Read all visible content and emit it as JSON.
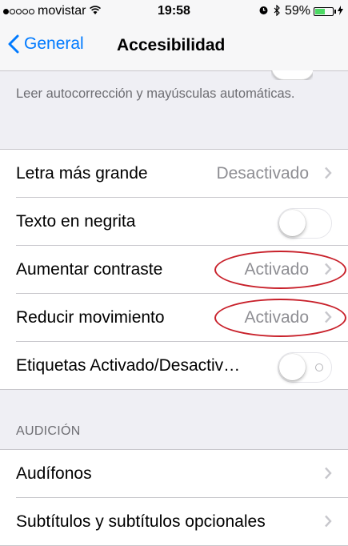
{
  "status_bar": {
    "carrier": "movistar",
    "signal_bars_filled": 1,
    "signal_bars_total": 5,
    "time": "19:58",
    "battery_percent": "59%",
    "battery_level": 0.59
  },
  "nav": {
    "back_label": "General",
    "title": "Accesibilidad"
  },
  "footer_note": "Leer autocorrección y mayúsculas automáticas.",
  "group1": [
    {
      "label": "Letra más grande",
      "value": "Desactivado",
      "type": "disclosure"
    },
    {
      "label": "Texto en negrita",
      "type": "switch",
      "on": false
    },
    {
      "label": "Aumentar contraste",
      "value": "Activado",
      "type": "disclosure",
      "circled": true
    },
    {
      "label": "Reducir movimiento",
      "value": "Activado",
      "type": "disclosure",
      "circled": true
    },
    {
      "label": "Etiquetas Activado/Desactiv…",
      "type": "switch",
      "on": false,
      "labels": true
    }
  ],
  "section_audicion": "AUDICIÓN",
  "group2": [
    {
      "label": "Audífonos",
      "type": "disclosure"
    },
    {
      "label": "Subtítulos y subtítulos opcionales",
      "type": "disclosure"
    }
  ],
  "colors": {
    "accent": "#007aff",
    "annotation": "#c8202a",
    "battery": "#4cd964"
  },
  "icons": {
    "wifi": "wifi-icon",
    "alarm": "alarm-icon",
    "bluetooth": "bluetooth-icon",
    "charging": "charging-bolt-icon",
    "back": "chevron-left-icon",
    "disclosure": "chevron-right-icon"
  }
}
